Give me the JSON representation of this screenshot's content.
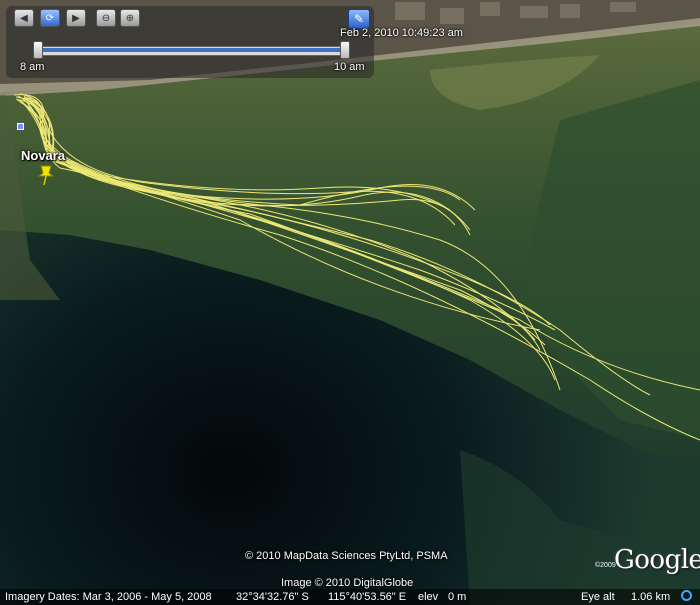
{
  "time_slider": {
    "start_label": "8 am",
    "end_label": "10 am",
    "current_datetime": "Feb 2, 2010 10:49:23 am",
    "buttons": {
      "skip_back": "skip-back",
      "options": "time-options",
      "skip_forward": "skip-forward",
      "zoom_out": "zoom-out",
      "zoom_in": "zoom-in",
      "settings": "wrench"
    }
  },
  "placemark": {
    "label": "Novara",
    "color": "#f2e600"
  },
  "track_color": "#f7f07a",
  "credits": {
    "mapdata": "© 2010 MapData Sciences PtyLtd, PSMA",
    "image": "Image © 2010 DigitalGlobe",
    "logo": "Google",
    "logo_year": "©2009"
  },
  "statusbar": {
    "imagery_dates": "Imagery Dates: Mar 3, 2006 - May 5, 2008",
    "latitude": "32°34'32.76\" S",
    "longitude": "115°40'53.56\" E",
    "elev_label": "elev",
    "elev_value": "0 m",
    "eye_alt_label": "Eye alt",
    "eye_alt_value": "1.06 km"
  }
}
